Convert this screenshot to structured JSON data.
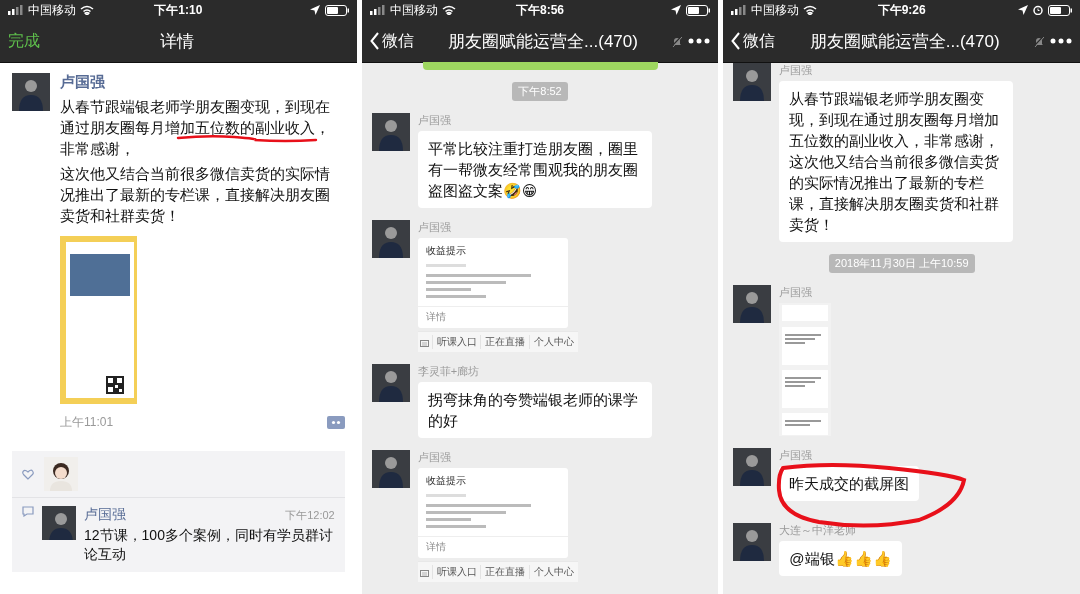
{
  "panels": [
    {
      "kind": "moments",
      "status_bar": {
        "carrier": "中国移动",
        "time": "下午1:10",
        "alarm": false
      },
      "nav": {
        "kind": "done",
        "left": "完成",
        "title": "详情"
      },
      "post": {
        "author": "卢国强",
        "text_before": "从春节跟端银老师学朋友圈变现，到现在通过朋友圈每月增",
        "marked": "加五位数的副业收入",
        "text_after": "，非常感谢，",
        "text_2": "这次他又结合当前很多微信卖货的实际情况推出了最新的专栏课，直接解决朋友圈卖货和社群卖货！",
        "time": "上午11:01",
        "comments": [
          {
            "author": "卢国强",
            "time": "下午12:02",
            "text": "12节课，100多个案例，同时有学员群讨论互动"
          }
        ]
      }
    },
    {
      "kind": "chat",
      "status_bar": {
        "carrier": "中国移动",
        "time": "下午8:56",
        "alarm": false
      },
      "nav": {
        "kind": "back",
        "left": "微信",
        "title": "朋友圈赋能运营全...(470)",
        "muted": true
      },
      "messages": [
        {
          "kind": "partial"
        },
        {
          "kind": "time",
          "text": "下午8:52"
        },
        {
          "kind": "text",
          "sender": "卢国强",
          "text": "平常比较注重打造朋友圈，圈里有一帮微友经常围观我的朋友圈盗图盗文案🤣😁",
          "circled": false
        },
        {
          "kind": "card",
          "sender": "卢国强",
          "title": "收益提示",
          "link": "详情",
          "menu": [
            "听课入口",
            "正在直播",
            "个人中心"
          ]
        },
        {
          "kind": "text",
          "sender": "李灵菲+廊坊",
          "text": "拐弯抹角的夸赞端银老师的课学的好",
          "circled": false
        },
        {
          "kind": "card",
          "sender": "卢国强",
          "title": "收益提示",
          "link": "详情",
          "menu": [
            "听课入口",
            "正在直播",
            "个人中心"
          ]
        }
      ]
    },
    {
      "kind": "chat",
      "status_bar": {
        "carrier": "中国移动",
        "time": "下午9:26",
        "alarm": true
      },
      "nav": {
        "kind": "back",
        "left": "微信",
        "title": "朋友圈赋能运营全...(470)",
        "muted": true
      },
      "messages": [
        {
          "kind": "text",
          "sender": "卢国强",
          "text": "从春节跟端银老师学朋友圈变现，到现在通过朋友圈每月增加五位数的副业收入，非常感谢，这次他又结合当前很多微信卖货的实际情况推出了最新的专栏课，直接解决朋友圈卖货和社群卖货！",
          "circled": false
        },
        {
          "kind": "time",
          "text": "2018年11月30日 上午10:59"
        },
        {
          "kind": "image",
          "sender": "卢国强"
        },
        {
          "kind": "text",
          "sender": "卢国强",
          "text": "昨天成交的截屏图",
          "circled": true
        },
        {
          "kind": "text",
          "sender": "大连～中洋老师",
          "text": "@端银👍👍👍",
          "circled": false
        }
      ]
    }
  ]
}
